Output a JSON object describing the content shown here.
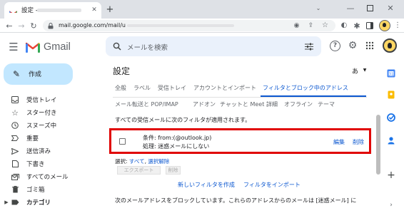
{
  "browser": {
    "tab_title": "設定 -",
    "url": "mail.google.com/mail/u"
  },
  "app": {
    "brand": "Gmail",
    "search_placeholder": "メールを検索"
  },
  "compose_label": "作成",
  "nav": [
    {
      "label": "受信トレイ",
      "icon": "inbox-icon"
    },
    {
      "label": "スター付き",
      "icon": "star-icon"
    },
    {
      "label": "スヌーズ中",
      "icon": "clock-icon"
    },
    {
      "label": "重要",
      "icon": "important-icon"
    },
    {
      "label": "送信済み",
      "icon": "send-icon"
    },
    {
      "label": "下書き",
      "icon": "draft-icon"
    },
    {
      "label": "すべてのメール",
      "icon": "all-mail-icon"
    },
    {
      "label": "ゴミ箱",
      "icon": "trash-icon"
    },
    {
      "label": "カテゴリ",
      "icon": "label-icon"
    }
  ],
  "settings": {
    "title": "設定",
    "language_indicator": "あ",
    "tabs_row1": [
      "全般",
      "ラベル",
      "受信トレイ",
      "アカウントとインポート",
      "フィルタとブロック中のアドレス"
    ],
    "tabs_row2": [
      "メール転送と POP/IMAP",
      "アドオン",
      "チャットと Meet",
      "詳細",
      "オフライン",
      "テーマ"
    ],
    "active_tab": "フィルタとブロック中のアドレス",
    "filters_heading": "すべての受信メールに次のフィルタが適用されます。",
    "filter": {
      "condition": "条件: from:(@outlook.jp)",
      "action": "処理: 迷惑メールにしない",
      "edit": "編集",
      "delete": "削除"
    },
    "select_label": "選択: ",
    "select_all": "すべて",
    "select_none": "選択解除",
    "export_button": "エクスポート",
    "delete_button": "削除",
    "create_filter": "新しいフィルタを作成",
    "import_filter": "フィルタをインポート",
    "blocked_text": "次のメールアドレスをブロックしています。これらのアドレスからのメールは [迷惑メール] に"
  },
  "colors": {
    "accent": "#0b57d0",
    "highlight_border": "#e00000",
    "compose_bg": "#c2e7ff"
  }
}
